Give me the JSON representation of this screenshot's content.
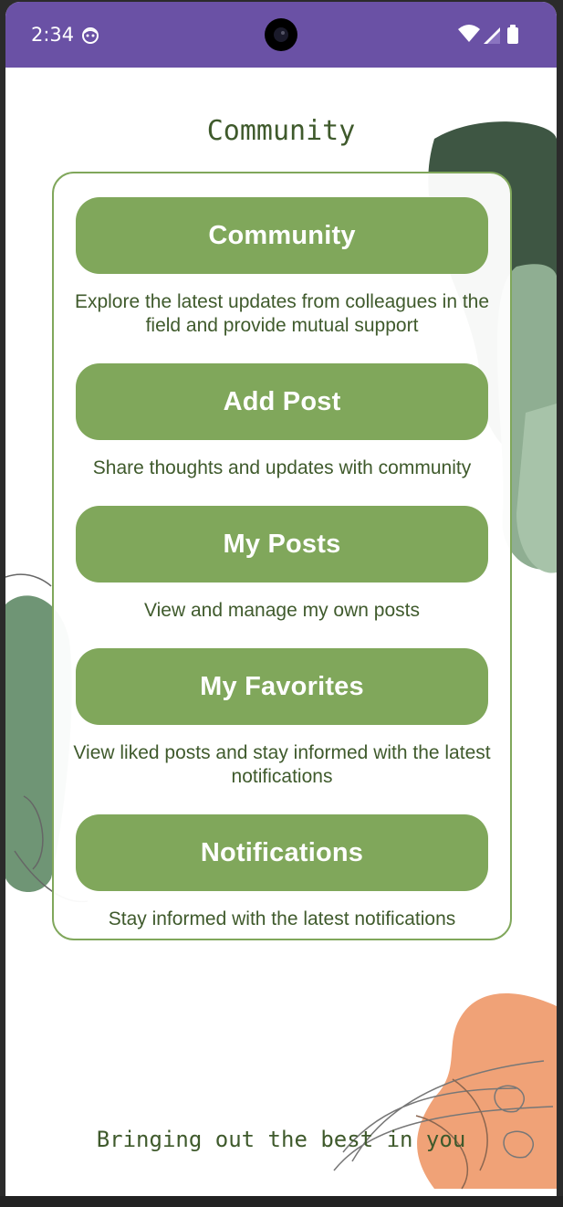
{
  "status_bar": {
    "time": "2:34",
    "icons": [
      "notification-face-icon",
      "camera-cutout",
      "wifi-icon",
      "signal-icon",
      "battery-icon"
    ]
  },
  "page": {
    "title": "Community",
    "tagline": "Bringing out the best in you"
  },
  "menu": [
    {
      "label": "Community",
      "description": "Explore the latest updates from colleagues in the field and provide mutual support"
    },
    {
      "label": "Add Post",
      "description": "Share thoughts and updates with community"
    },
    {
      "label": "My Posts",
      "description": "View and manage my own posts"
    },
    {
      "label": "My Favorites",
      "description": "View liked posts and stay informed with the latest notifications"
    },
    {
      "label": "Notifications",
      "description": "Stay informed with the latest notifications"
    }
  ],
  "colors": {
    "status_bar": "#6a51a5",
    "button": "#80a75b",
    "text_green": "#3f5a2c",
    "accent_dark": "#3e5643",
    "accent_sage": "#8fae92",
    "accent_peach": "#f0a277"
  }
}
